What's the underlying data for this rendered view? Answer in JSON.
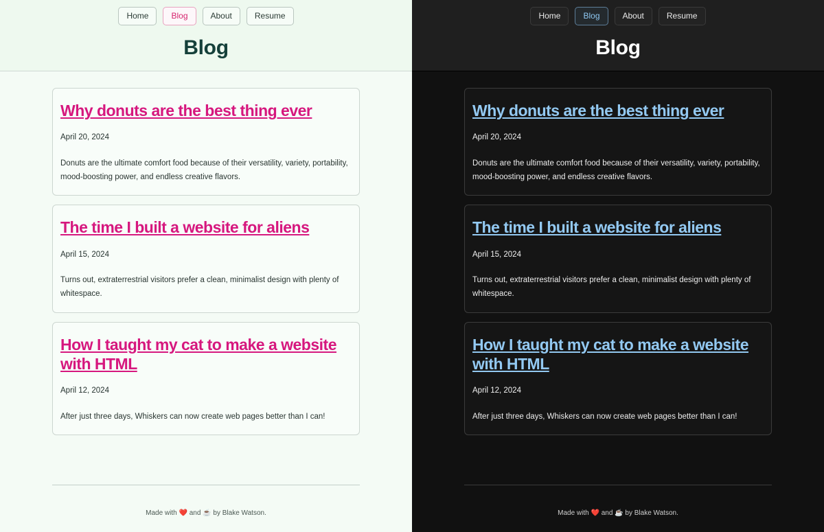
{
  "panes": [
    {
      "theme": "light",
      "name": "light-theme-pane"
    },
    {
      "theme": "dark",
      "name": "dark-theme-pane"
    }
  ],
  "header": {
    "title": "Blog",
    "nav": [
      {
        "label": "Home",
        "active": false
      },
      {
        "label": "Blog",
        "active": true
      },
      {
        "label": "About",
        "active": false
      },
      {
        "label": "Resume",
        "active": false
      }
    ]
  },
  "posts": [
    {
      "title": "Why donuts are the best thing ever",
      "date": "April 20, 2024",
      "excerpt": "Donuts are the ultimate comfort food because of their versatility, variety, portability, mood-boosting power, and endless creative flavors."
    },
    {
      "title": "The time I built a website for aliens",
      "date": "April 15, 2024",
      "excerpt": "Turns out, extraterrestrial visitors prefer a clean, minimalist design with plenty of whitespace."
    },
    {
      "title": "How I taught my cat to make a website with HTML",
      "date": "April 12, 2024",
      "excerpt": "After just three days, Whiskers can now create web pages better than I can!"
    }
  ],
  "footer": {
    "prefix": "Made with ",
    "heart_icon": "❤️",
    "middle": " and ",
    "coffee_icon": "☕",
    "suffix": " by Blake Watson."
  },
  "colors": {
    "light_bg": "#f4fbf5",
    "light_header_bg": "#eef9ef",
    "light_link": "#d6177e",
    "light_title": "#15403a",
    "light_card_border": "#ccd6d0",
    "dark_bg": "#111111",
    "dark_header_bg": "#1f1f1f",
    "dark_link": "#93c9f2",
    "dark_title": "#ffffff",
    "dark_card_border": "#3b3b3b"
  }
}
